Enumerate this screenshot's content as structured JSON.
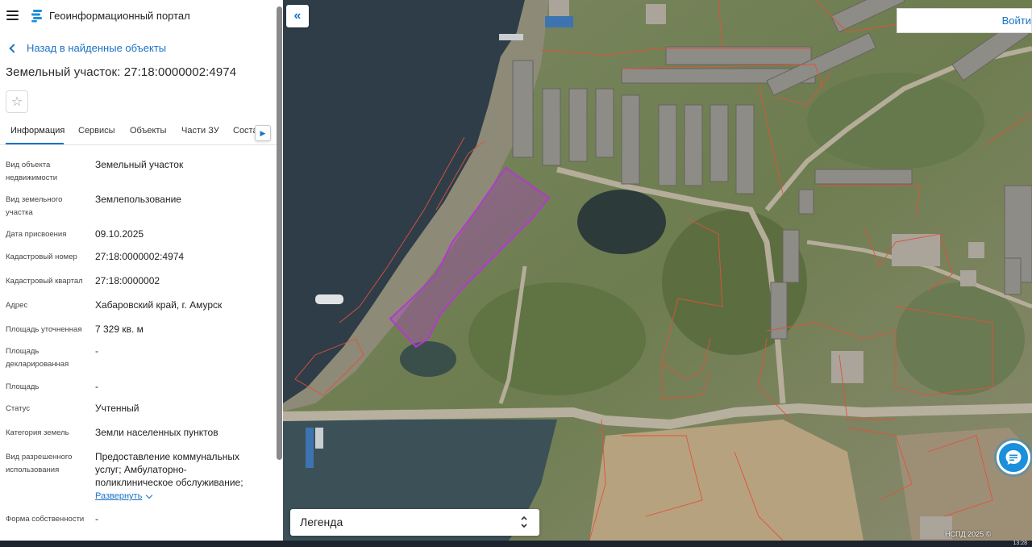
{
  "header": {
    "portal_title": "Геоинформационный портал"
  },
  "nav": {
    "back_label": "Назад в найденные объекты"
  },
  "object": {
    "title": "Земельный участок: 27:18:0000002:4974"
  },
  "tabs": [
    {
      "label": "Информация",
      "active": true
    },
    {
      "label": "Сервисы"
    },
    {
      "label": "Объекты"
    },
    {
      "label": "Части ЗУ"
    },
    {
      "label": "Соста"
    }
  ],
  "attributes": [
    {
      "label": "Вид объекта недвижимости",
      "value": "Земельный участок"
    },
    {
      "label": "Вид земельного участка",
      "value": "Землепользование"
    },
    {
      "label": "Дата присвоения",
      "value": "09.10.2025"
    },
    {
      "label": "Кадастровый номер",
      "value": "27:18:0000002:4974"
    },
    {
      "label": "Кадастровый квартал",
      "value": "27:18:0000002"
    },
    {
      "label": "Адрес",
      "value": "Хабаровский край, г. Амурск"
    },
    {
      "label": "Площадь уточненная",
      "value": "7 329 кв. м"
    },
    {
      "label": "Площадь декларированная",
      "value": "-"
    },
    {
      "label": "Площадь",
      "value": "-"
    },
    {
      "label": "Статус",
      "value": "Учтенный"
    },
    {
      "label": "Категория земель",
      "value": "Земли населенных пунктов"
    },
    {
      "label": "Вид разрешенного использования",
      "value": "Предоставление коммунальных услуг; Амбулаторно-поликлиническое обслуживание;"
    },
    {
      "label": "Форма собственности",
      "value": "-"
    }
  ],
  "expand_label": "Развернуть",
  "map": {
    "login_label": "Войти",
    "legend_label": "Легенда",
    "attribution": "НСПД 2025 ©",
    "highlight_color": "#b03cc8",
    "parcel_line_color": "#e0523a"
  },
  "taskbar": {
    "clock": "13:28"
  }
}
